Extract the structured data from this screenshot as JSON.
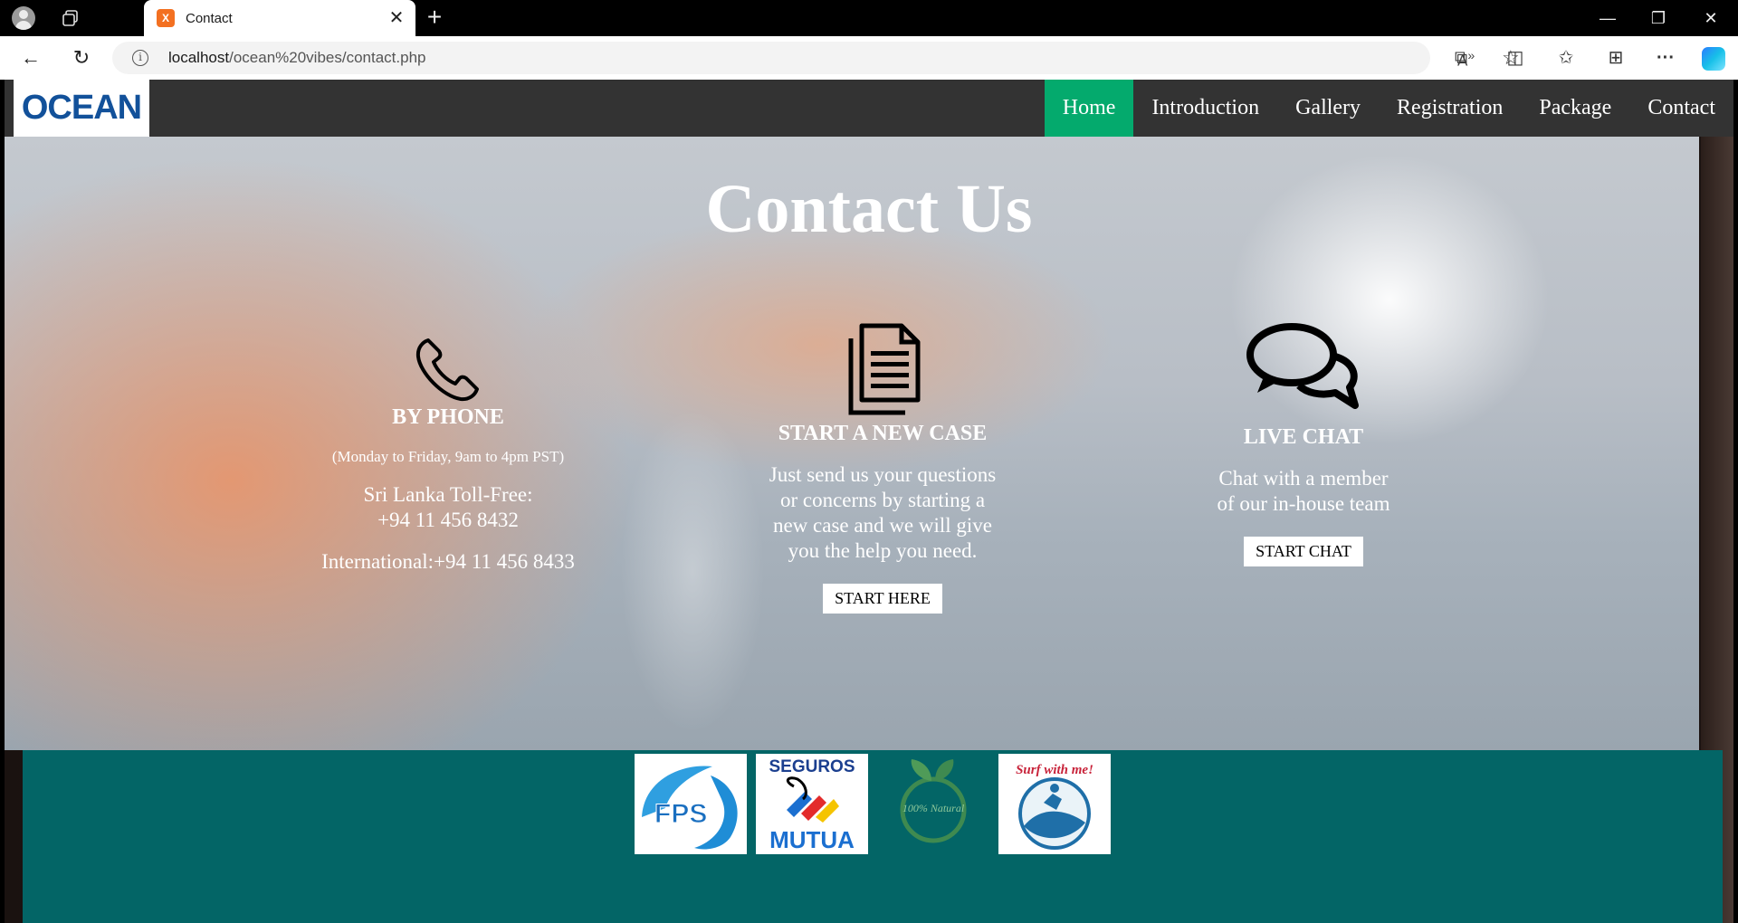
{
  "browser": {
    "tab_title": "Contact",
    "tab_favicon_glyph": "X",
    "url_host": "localhost",
    "url_path": "/ocean%20vibes/contact.php",
    "icons": [
      "profile-icon",
      "workspaces-icon",
      "close-icon",
      "plus-icon",
      "minimize-icon",
      "restore-icon",
      "window-close-icon",
      "back-icon",
      "reload-icon",
      "info-icon",
      "read-aloud-icon",
      "favorite-star-icon",
      "extensions-icon",
      "split-screen-icon",
      "favorites-icon",
      "collections-icon",
      "more-icon",
      "copilot-icon"
    ]
  },
  "site": {
    "logo": "OCEAN",
    "nav": [
      {
        "label": "Home",
        "active": true
      },
      {
        "label": "Introduction"
      },
      {
        "label": "Gallery"
      },
      {
        "label": "Registration"
      },
      {
        "label": "Package"
      },
      {
        "label": "Contact"
      }
    ],
    "hero_title": "Contact Us",
    "phone": {
      "heading": "BY PHONE",
      "hours": "(Monday to Friday, 9am to 4pm PST)",
      "tollfree_label": "Sri Lanka Toll-Free:",
      "tollfree_number": "+94 11 456 8432",
      "international": "International:+94 11 456 8433"
    },
    "case": {
      "heading": "START A NEW CASE",
      "text": "Just send us your questions or concerns by starting a new case and we will give you the help you need.",
      "button": "START HERE"
    },
    "chat": {
      "heading": "LIVE CHAT",
      "text": "Chat with a member of our in-house team",
      "button": "START CHAT"
    },
    "partners": {
      "fps": "FPS",
      "mutua_top": "SEGUROS",
      "mutua_bottom": "MUTUA",
      "natural": "100% Natural",
      "surf": "Surf with me!"
    }
  }
}
